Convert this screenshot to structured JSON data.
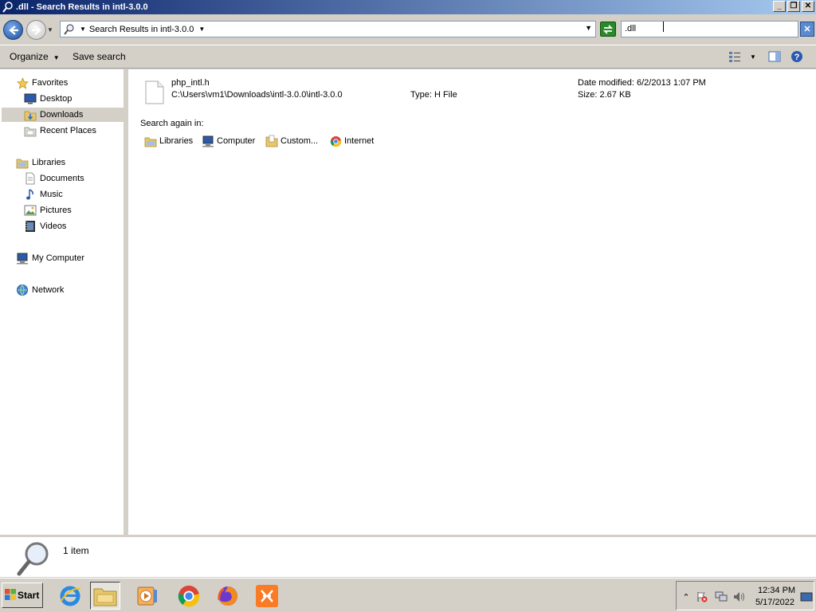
{
  "window": {
    "title": ".dll - Search Results in intl-3.0.0",
    "buttons": {
      "minimize": "_",
      "restore": "❐",
      "close": "✕"
    }
  },
  "address": {
    "breadcrumb": "Search Results in intl-3.0.0",
    "search_value": ".dll"
  },
  "toolbar": {
    "organize_label": "Organize",
    "save_search_label": "Save search"
  },
  "nav": {
    "favorites": "Favorites",
    "desktop": "Desktop",
    "downloads": "Downloads",
    "recent_places": "Recent Places",
    "libraries": "Libraries",
    "documents": "Documents",
    "music": "Music",
    "pictures": "Pictures",
    "videos": "Videos",
    "my_computer": "My Computer",
    "network": "Network"
  },
  "result": {
    "name": "php_intl.h",
    "path": "C:\\Users\\vm1\\Downloads\\intl-3.0.0\\intl-3.0.0",
    "type": "Type: H File",
    "date_modified": "Date modified: 6/2/2013 1:07 PM",
    "size": "Size: 2.67 KB"
  },
  "search_again": {
    "label": "Search again in:",
    "libraries": "Libraries",
    "computer": "Computer",
    "custom": "Custom...",
    "internet": "Internet"
  },
  "details": {
    "count": "1 item"
  },
  "taskbar": {
    "start_label": "Start",
    "apps": [
      "internet-explorer-icon",
      "windows-explorer-icon",
      "media-player-icon",
      "chrome-icon",
      "firefox-icon",
      "xampp-icon"
    ],
    "time": "12:34 PM",
    "date": "5/17/2022"
  }
}
